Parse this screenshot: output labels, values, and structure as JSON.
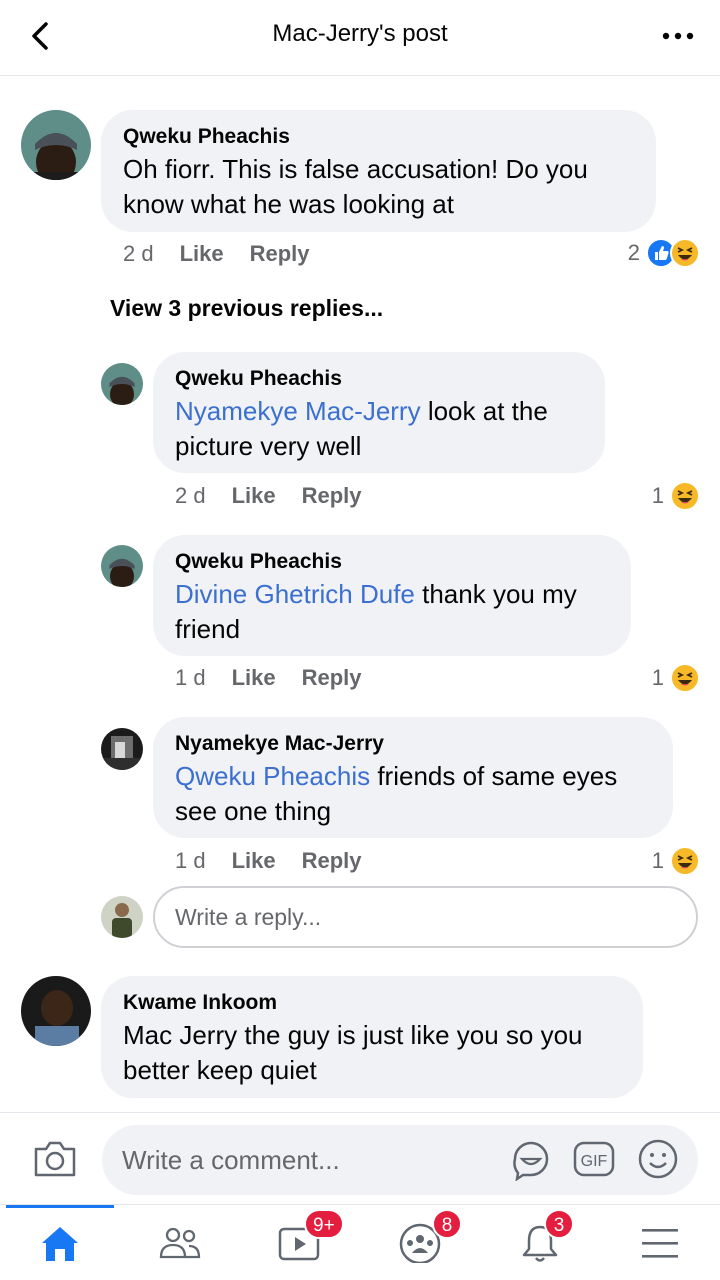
{
  "header": {
    "title": "Mac-Jerry's post"
  },
  "comments": [
    {
      "author": "Qweku Pheachis",
      "mention": "",
      "text": "Oh fiorr.  This is false accusation! Do you know what he was looking at",
      "time": "2 d",
      "like_label": "Like",
      "reply_label": "Reply",
      "reaction_count": "2",
      "reactions": [
        "like-icon",
        "haha-icon"
      ]
    }
  ],
  "view_previous": "View 3 previous replies...",
  "replies": [
    {
      "author": "Qweku Pheachis",
      "mention": "Nyamekye Mac-Jerry",
      "text": " look at the picture very well",
      "time": "2 d",
      "like_label": "Like",
      "reply_label": "Reply",
      "reaction_count": "1"
    },
    {
      "author": "Qweku Pheachis",
      "mention": "Divine Ghetrich Dufe",
      "text": " thank you my friend",
      "time": "1 d",
      "like_label": "Like",
      "reply_label": "Reply",
      "reaction_count": "1"
    },
    {
      "author": "Nyamekye Mac-Jerry",
      "mention": "Qweku Pheachis",
      "text": " friends of same eyes see one thing",
      "time": "1 d",
      "like_label": "Like",
      "reply_label": "Reply",
      "reaction_count": "1"
    }
  ],
  "reply_box": {
    "placeholder": "Write a reply..."
  },
  "second_comment": {
    "author": "Kwame Inkoom",
    "text": "Mac Jerry the guy is just like you so you better keep quiet"
  },
  "composer": {
    "placeholder": "Write a comment..."
  },
  "tabs": [
    {
      "name": "home",
      "badge": ""
    },
    {
      "name": "friends",
      "badge": ""
    },
    {
      "name": "watch",
      "badge": "9+"
    },
    {
      "name": "groups",
      "badge": "8"
    },
    {
      "name": "notifications",
      "badge": "3"
    },
    {
      "name": "menu",
      "badge": ""
    }
  ],
  "colors": {
    "accent": "#1877f2",
    "mention": "#3b6fd0",
    "badge": "#e41e3f",
    "bubble": "#f0f2f5",
    "haha": "#f7b928"
  }
}
